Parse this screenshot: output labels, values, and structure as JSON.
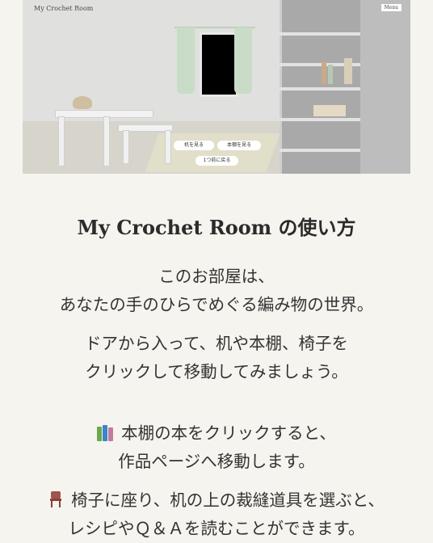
{
  "hero": {
    "logo": "My Crochet Room",
    "menu_label": "Menu",
    "buttons": {
      "desk": "机を見る",
      "bookshelf": "本棚を見る",
      "back": "1つ前に戻る"
    }
  },
  "content": {
    "title": "My Crochet Room の使い方",
    "intro": [
      "このお部屋は、",
      "あなたの手のひらでめぐる編み物の世界。"
    ],
    "door": [
      "ドアから入って、机や本棚、椅子を",
      "クリックして移動してみましょう。"
    ],
    "bookshelf": [
      "本棚の本をクリックすると、",
      "作品ページへ移動します。"
    ],
    "chair": [
      "椅子に座り、机の上の裁縫道具を選ぶと、",
      "レシピやＱ＆Ａを読むことができます。"
    ]
  },
  "icons": {
    "book_emoji": "books-icon",
    "chair_emoji": "chair-icon"
  }
}
